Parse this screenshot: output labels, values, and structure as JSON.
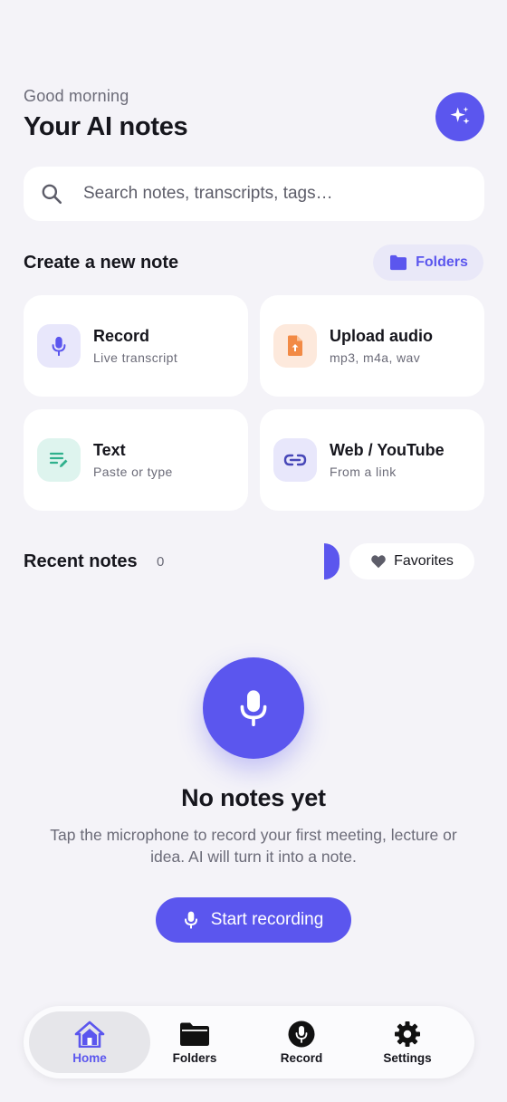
{
  "header": {
    "greeting": "Good morning",
    "title": "Your AI notes",
    "ai_icon": "sparkles-icon"
  },
  "search": {
    "placeholder": "Search notes, transcripts, tags…",
    "icon": "search-icon"
  },
  "create": {
    "title": "Create a new note",
    "folders_label": "Folders",
    "cards": [
      {
        "title": "Record",
        "subtitle": "Live transcript",
        "icon": "microphone-icon"
      },
      {
        "title": "Upload audio",
        "subtitle": "mp3, m4a, wav",
        "icon": "file-upload-icon"
      },
      {
        "title": "Text",
        "subtitle": "Paste or type",
        "icon": "text-edit-icon"
      },
      {
        "title": "Web / YouTube",
        "subtitle": "From a link",
        "icon": "link-icon"
      }
    ]
  },
  "recent": {
    "title": "Recent notes",
    "count": "0",
    "favorites_label": "Favorites"
  },
  "empty_state": {
    "title": "No notes yet",
    "description": "Tap the microphone to record your first meeting, lecture or idea. AI will turn it into a note.",
    "button_label": "Start recording"
  },
  "nav": {
    "items": [
      {
        "label": "Home",
        "icon": "home-icon",
        "active": true
      },
      {
        "label": "Folders",
        "icon": "folder-icon",
        "active": false
      },
      {
        "label": "Record",
        "icon": "microphone-icon",
        "active": false
      },
      {
        "label": "Settings",
        "icon": "gear-icon",
        "active": false
      }
    ]
  },
  "colors": {
    "accent": "#5b56ee",
    "background": "#f4f3f8",
    "text": "#16161d",
    "muted": "#6b6b78"
  }
}
